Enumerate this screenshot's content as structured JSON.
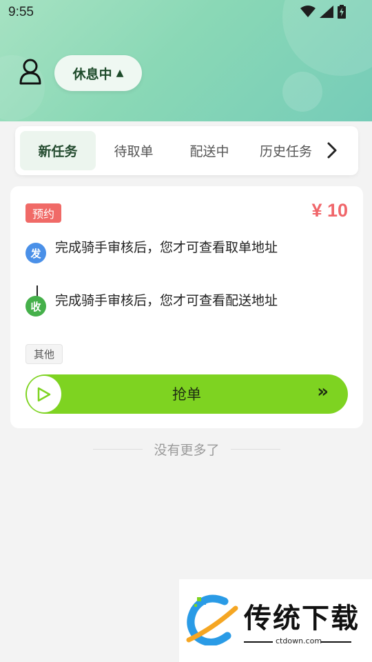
{
  "status_bar": {
    "time": "9:55",
    "icons": [
      "wifi-icon",
      "signal-icon",
      "battery-charging-icon"
    ]
  },
  "header": {
    "avatar_icon": "user-icon",
    "rest_status": {
      "label": "休息中",
      "arrow": "▲"
    }
  },
  "tabs": [
    {
      "label": "新任务",
      "active": true
    },
    {
      "label": "待取单",
      "active": false
    },
    {
      "label": "配送中",
      "active": false
    },
    {
      "label": "历史任务",
      "active": false
    }
  ],
  "tab_more_icon": "chevron-right-icon",
  "order": {
    "badge": "预约",
    "price": "¥ 10",
    "pickup": {
      "marker": "发",
      "text": "完成骑手审核后，您才可查看取单地址"
    },
    "delivery": {
      "marker": "收",
      "text": "完成骑手审核后，您才可查看配送地址"
    },
    "tag": "其他",
    "grab": {
      "label": "抢单",
      "chevron": "»"
    }
  },
  "footer_text": "没有更多了",
  "watermark": {
    "title": "传统下载",
    "url": "ctdown.com"
  },
  "colors": {
    "header_green": "#8ad8b6",
    "price_red": "#f0666a",
    "slider_green": "#7ed321",
    "send_blue": "#4a90e8",
    "recv_green": "#45b04a"
  }
}
